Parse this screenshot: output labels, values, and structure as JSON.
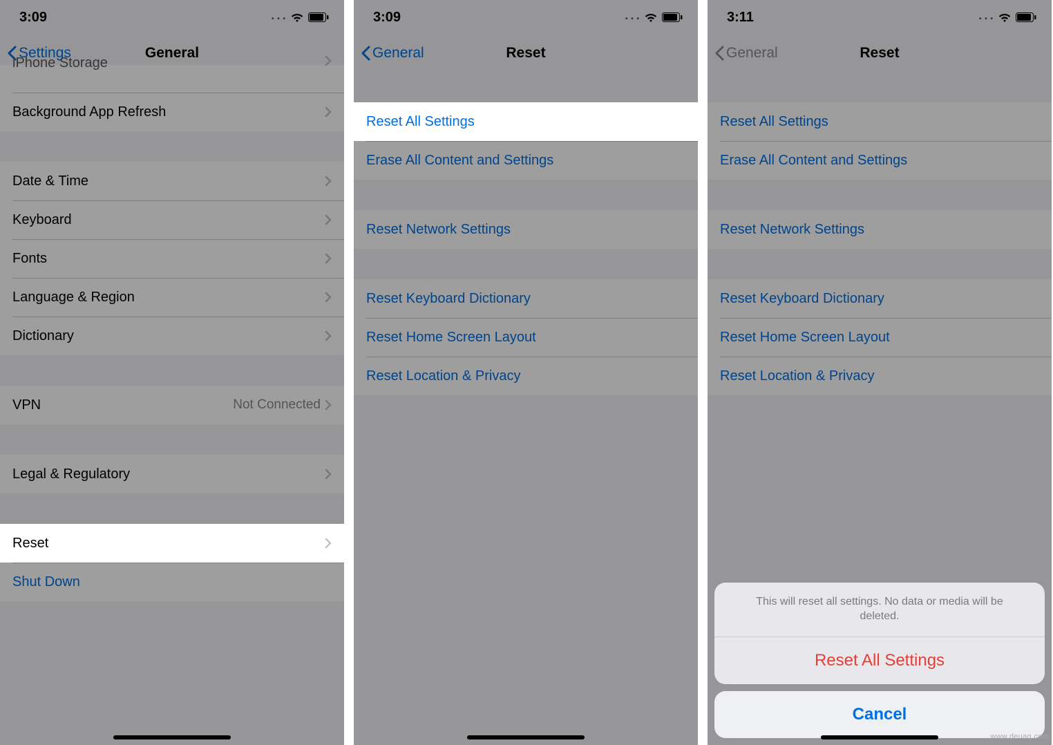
{
  "screens": {
    "s1": {
      "time": "3:09",
      "nav": {
        "back": "Settings",
        "title": "General"
      },
      "rows": {
        "iphone_storage": "iPhone Storage",
        "bg_refresh": "Background App Refresh",
        "date_time": "Date & Time",
        "keyboard": "Keyboard",
        "fonts": "Fonts",
        "lang_region": "Language & Region",
        "dictionary": "Dictionary",
        "vpn": "VPN",
        "vpn_detail": "Not Connected",
        "legal": "Legal & Regulatory",
        "reset": "Reset",
        "shutdown": "Shut Down"
      }
    },
    "s2": {
      "time": "3:09",
      "nav": {
        "back": "General",
        "title": "Reset"
      },
      "rows": {
        "reset_all": "Reset All Settings",
        "erase_all": "Erase All Content and Settings",
        "reset_network": "Reset Network Settings",
        "reset_keyboard": "Reset Keyboard Dictionary",
        "reset_home": "Reset Home Screen Layout",
        "reset_loc": "Reset Location & Privacy"
      }
    },
    "s3": {
      "time": "3:11",
      "nav": {
        "back": "General",
        "title": "Reset"
      },
      "sheet": {
        "message": "This will reset all settings. No data or media will be deleted.",
        "confirm": "Reset All Settings",
        "cancel": "Cancel"
      }
    }
  },
  "watermark": "www.deuaq.com"
}
